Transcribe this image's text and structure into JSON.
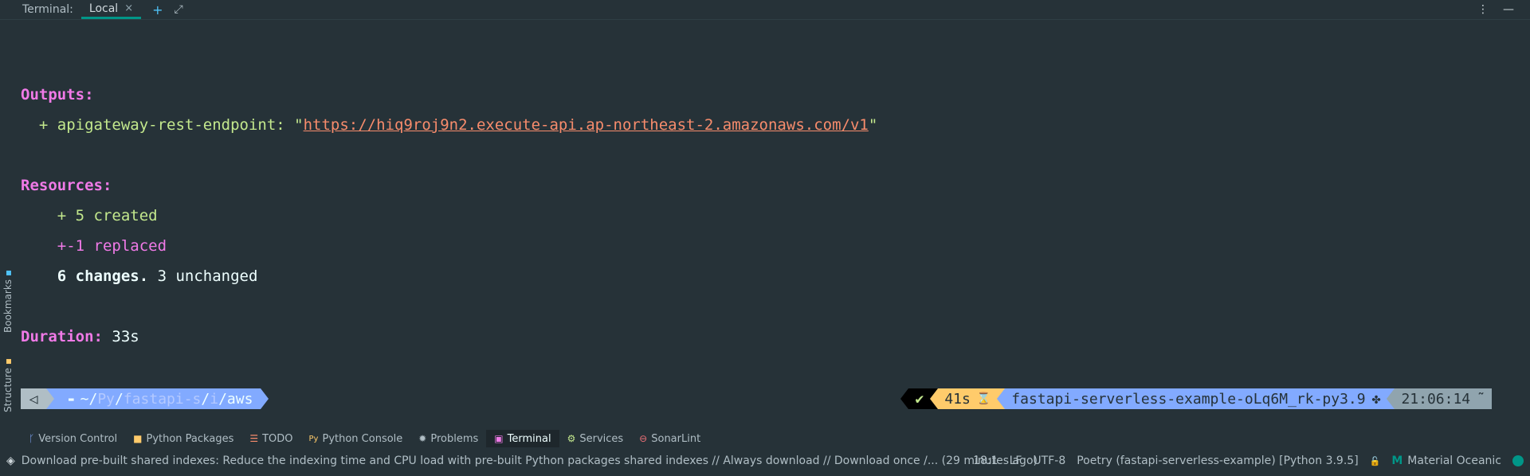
{
  "header": {
    "title": "Terminal:",
    "tab_label": "Local",
    "tab_close": "×",
    "add_label": "+",
    "expand_label": "⤢",
    "more_label": "⋮",
    "minimize_label": "—"
  },
  "left_strip": {
    "structure_label": "Structure",
    "bookmarks_label": "Bookmarks"
  },
  "terminal": {
    "outputs_label": "Outputs:",
    "endpoint_prefix": "  + apigateway-rest-endpoint: \"",
    "endpoint_url": "https://hiq9roj9n2.execute-api.ap-northeast-2.amazonaws.com/v1",
    "endpoint_suffix": "\"",
    "resources_label": "Resources:",
    "created_line": "    + 5 created",
    "replaced_line": "    +-1 replaced",
    "changes_count": "    6 changes.",
    "unchanged_text": " 3 unchanged",
    "duration_label": "Duration:",
    "duration_value": " 33s"
  },
  "prompt": {
    "back_icon": "◁",
    "folder_icon": "▬",
    "path_home": "~/",
    "path_py": "Py",
    "path_sep1": "/",
    "path_fastapi": "fastapi-s",
    "path_sep2": "/",
    "path_i": "i",
    "path_sep3": "/",
    "path_aws": "aws",
    "status_ok": "✔",
    "duration": "41s",
    "hourglass": "⌛",
    "env_name": "fastapi-serverless-example-oLq6M_rk-py3.9",
    "env_icon": "✤",
    "time": "21:06:14",
    "time_icon": "˜"
  },
  "tool_windows": [
    {
      "label": "Version Control",
      "icon": "ᚴ"
    },
    {
      "label": "Python Packages",
      "icon": "■"
    },
    {
      "label": "TODO",
      "icon": "☰"
    },
    {
      "label": "Python Console",
      "icon": "Py"
    },
    {
      "label": "Problems",
      "icon": "✹"
    },
    {
      "label": "Terminal",
      "icon": "▣"
    },
    {
      "label": "Services",
      "icon": "⚙"
    },
    {
      "label": "SonarLint",
      "icon": "⊖"
    }
  ],
  "status_bar": {
    "message": "Download pre-built shared indexes: Reduce the indexing time and CPU load with pre-built Python packages shared indexes // Always download // Download once /... (29 minutes ago)",
    "position": "18:1",
    "line_ending": "LF",
    "encoding": "UTF-8",
    "interpreter": "Poetry (fastapi-serverless-example) [Python 3.9.5]",
    "lock_icon": "🔓",
    "theme": "Material Oceanic",
    "theme_icon": "M"
  },
  "colors": {
    "background": "#263238",
    "accent": "#009688",
    "keyword": "#f07ae7",
    "green": "#c3e88d",
    "url": "#f78c6c",
    "blue_segment": "#82aaff",
    "yellow_segment": "#ffcb6b"
  }
}
